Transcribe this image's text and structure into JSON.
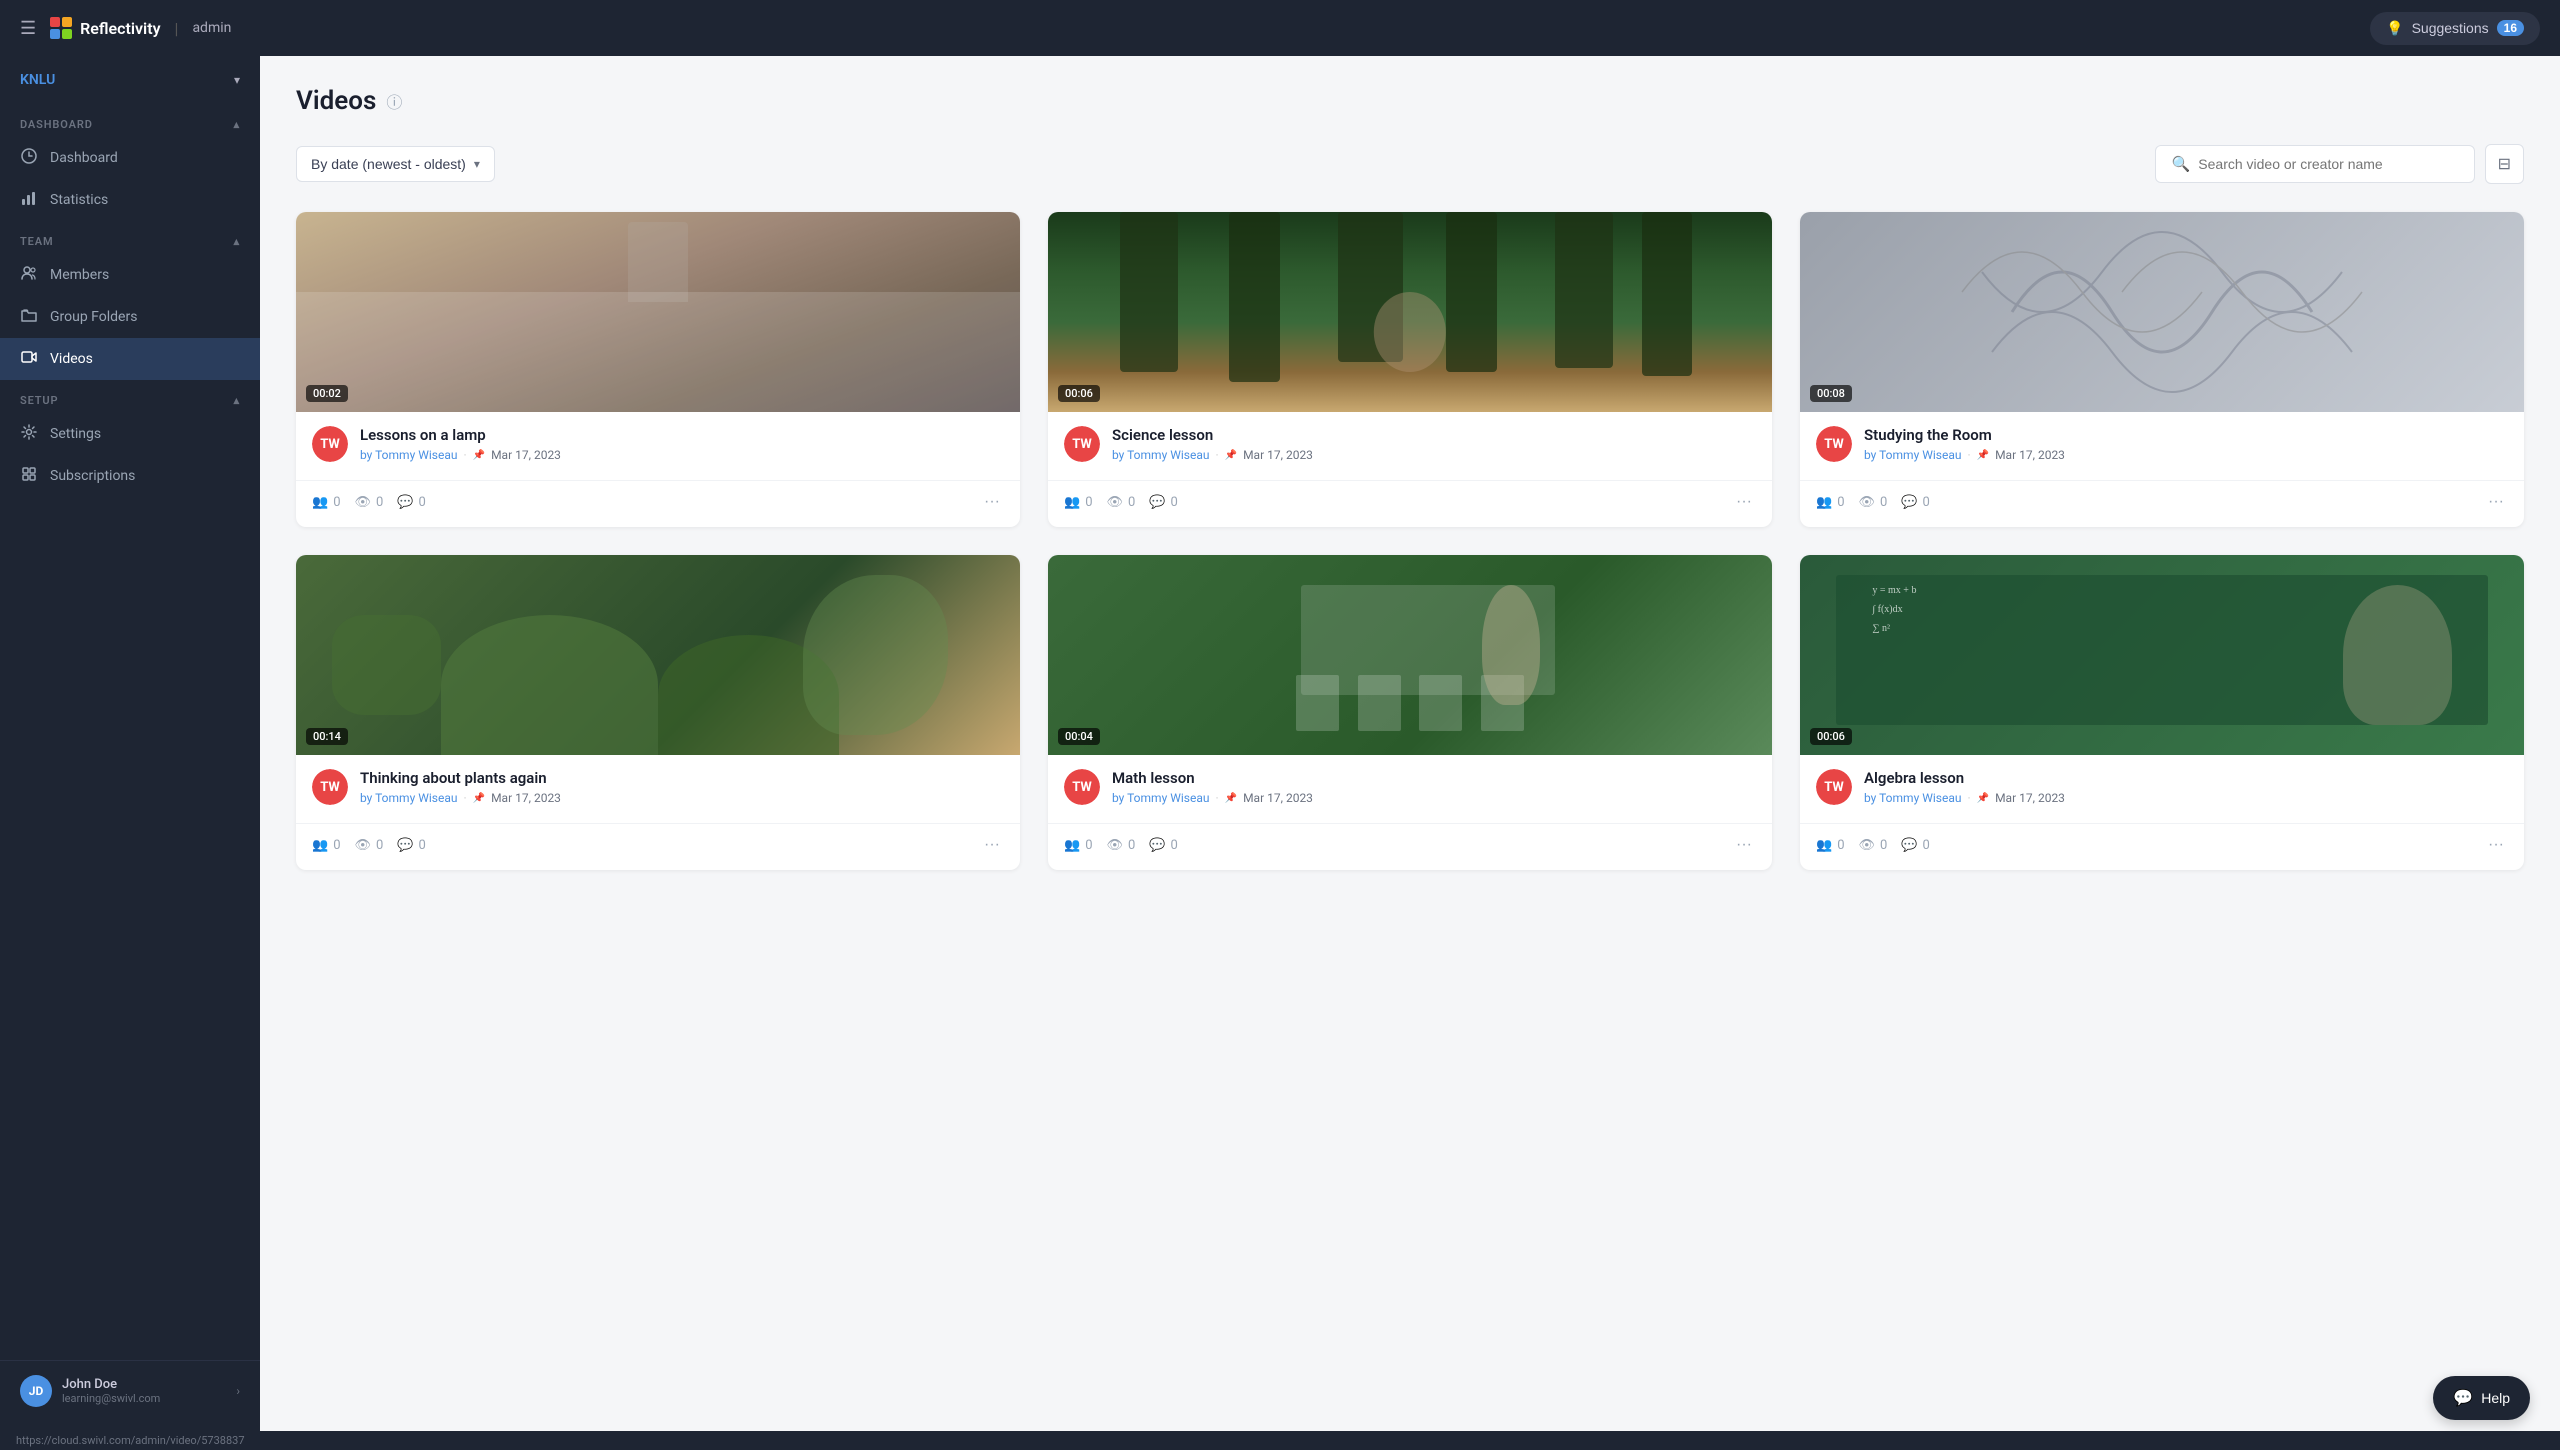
{
  "app": {
    "name": "Reflectivity",
    "role": "admin",
    "suggestions_label": "Suggestions",
    "suggestions_count": "16"
  },
  "sidebar": {
    "org": "KNLU",
    "sections": [
      {
        "label": "DASHBOARD",
        "items": [
          {
            "id": "dashboard",
            "label": "Dashboard",
            "icon": "⊘",
            "active": false
          },
          {
            "id": "statistics",
            "label": "Statistics",
            "icon": "📊",
            "active": false
          }
        ]
      },
      {
        "label": "TEAM",
        "items": [
          {
            "id": "members",
            "label": "Members",
            "icon": "👤",
            "active": false
          },
          {
            "id": "group-folders",
            "label": "Group Folders",
            "icon": "📁",
            "active": false
          },
          {
            "id": "videos",
            "label": "Videos",
            "icon": "🎬",
            "active": true
          }
        ]
      },
      {
        "label": "SETUP",
        "items": [
          {
            "id": "settings",
            "label": "Settings",
            "icon": "⚙",
            "active": false
          },
          {
            "id": "subscriptions",
            "label": "Subscriptions",
            "icon": "🔲",
            "active": false
          }
        ]
      }
    ],
    "user": {
      "initials": "JD",
      "name": "John Doe",
      "email": "learning@swivl.com"
    }
  },
  "page": {
    "title": "Videos",
    "sort_label": "By date (newest - oldest)",
    "search_placeholder": "Search video or creator name"
  },
  "videos": [
    {
      "id": "v1",
      "title": "Lessons on a lamp",
      "creator": "Tommy Wiseau",
      "creator_initials": "TW",
      "creator_color": "#e84545",
      "date": "Mar 17, 2023",
      "duration": "00:02",
      "shares": 0,
      "views": 0,
      "comments": 0,
      "thumb_class": "thumb-lamp"
    },
    {
      "id": "v2",
      "title": "Science lesson",
      "creator": "Tommy Wiseau",
      "creator_initials": "TW",
      "creator_color": "#e84545",
      "date": "Mar 17, 2023",
      "duration": "00:06",
      "shares": 0,
      "views": 0,
      "comments": 0,
      "thumb_class": "thumb-forest"
    },
    {
      "id": "v3",
      "title": "Studying the Room",
      "creator": "Tommy Wiseau",
      "creator_initials": "TW",
      "creator_color": "#e84545",
      "date": "Mar 17, 2023",
      "duration": "00:08",
      "shares": 0,
      "views": 0,
      "comments": 0,
      "thumb_class": "thumb-swirl"
    },
    {
      "id": "v4",
      "title": "Thinking about plants again",
      "creator": "Tommy Wiseau",
      "creator_initials": "TW",
      "creator_color": "#e84545",
      "date": "Mar 17, 2023",
      "duration": "00:14",
      "shares": 0,
      "views": 0,
      "comments": 0,
      "thumb_class": "thumb-plants"
    },
    {
      "id": "v5",
      "title": "Math lesson",
      "creator": "Tommy Wiseau",
      "creator_initials": "TW",
      "creator_color": "#e84545",
      "date": "Mar 17, 2023",
      "duration": "00:04",
      "shares": 0,
      "views": 0,
      "comments": 0,
      "thumb_class": "thumb-classroom"
    },
    {
      "id": "v6",
      "title": "Algebra lesson",
      "creator": "Tommy Wiseau",
      "creator_initials": "TW",
      "creator_color": "#e84545",
      "date": "Mar 17, 2023",
      "duration": "00:06",
      "shares": 0,
      "views": 0,
      "comments": 0,
      "thumb_class": "thumb-chalkboard"
    }
  ],
  "help_label": "Help",
  "statusbar_url": "https://cloud.swivl.com/admin/video/5738837"
}
